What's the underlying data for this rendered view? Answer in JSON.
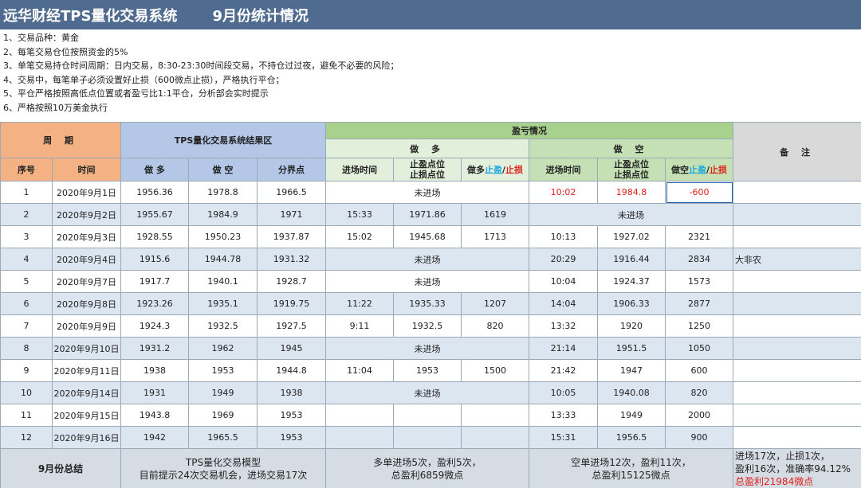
{
  "title": "远华财经TPS量化交易系统",
  "month_title": "9月份统计情况",
  "rules": [
    "1、交易品种：黄金",
    "2、每笔交易仓位按照资金的5%",
    "3、单笔交易持仓时间周期：日内交易，8:30-23:30时间段交易，不持仓过过夜，避免不必要的风险；",
    "4、交易中，每笔单子必须设置好止损（600微点止损），严格执行平仓；",
    "5、平仓严格按照高低点位置或者盈亏比1:1平仓，分析部会实时提示",
    "6、严格按照10万美金执行"
  ],
  "headers": {
    "period": "周  期",
    "tps_area": "TPS量化交易系统结果区",
    "pl": "盈亏情况",
    "long": "做  多",
    "short": "做  空",
    "note": "备  注",
    "seq": "序号",
    "time": "时间",
    "tps_long": "做  多",
    "tps_short": "做  空",
    "boundary": "分界点",
    "long_entry": "进场时间",
    "long_stop_l1": "止盈点位",
    "long_stop_l2": "止损点位",
    "long_pl_prefix": "做多",
    "short_entry": "进场时间",
    "short_stop_l1": "止盈点位",
    "short_stop_l2": "止损点位",
    "short_pl_prefix": "做空",
    "tp_word": "止盈",
    "slash": "/",
    "sl_word": "止损"
  },
  "rows": [
    {
      "seq": "1",
      "date": "2020年9月1日",
      "tps_long": "1956.36",
      "tps_short": "1978.8",
      "boundary": "1966.5",
      "long_merged": "未进场",
      "short_entry": "10:02",
      "short_point": "1984.8",
      "short_pl": "-600",
      "note": ""
    },
    {
      "seq": "2",
      "date": "2020年9月2日",
      "tps_long": "1955.67",
      "tps_short": "1984.9",
      "boundary": "1971",
      "long_entry": "15:33",
      "long_point": "1971.86",
      "long_pl": "1619",
      "short_merged": "未进场",
      "note": ""
    },
    {
      "seq": "3",
      "date": "2020年9月3日",
      "tps_long": "1928.55",
      "tps_short": "1950.23",
      "boundary": "1937.87",
      "long_entry": "15:02",
      "long_point": "1945.68",
      "long_pl": "1713",
      "short_entry": "10:13",
      "short_point": "1927.02",
      "short_pl": "2321",
      "note": ""
    },
    {
      "seq": "4",
      "date": "2020年9月4日",
      "tps_long": "1915.6",
      "tps_short": "1944.78",
      "boundary": "1931.32",
      "long_merged": "未进场",
      "short_entry": "20:29",
      "short_point": "1916.44",
      "short_pl": "2834",
      "note": "大非农"
    },
    {
      "seq": "5",
      "date": "2020年9月7日",
      "tps_long": "1917.7",
      "tps_short": "1940.1",
      "boundary": "1928.7",
      "long_merged": "未进场",
      "short_entry": "10:04",
      "short_point": "1924.37",
      "short_pl": "1573",
      "note": ""
    },
    {
      "seq": "6",
      "date": "2020年9月8日",
      "tps_long": "1923.26",
      "tps_short": "1935.1",
      "boundary": "1919.75",
      "long_entry": "11:22",
      "long_point": "1935.33",
      "long_pl": "1207",
      "short_entry": "14:04",
      "short_point": "1906.33",
      "short_pl": "2877",
      "note": ""
    },
    {
      "seq": "7",
      "date": "2020年9月9日",
      "tps_long": "1924.3",
      "tps_short": "1932.5",
      "boundary": "1927.5",
      "long_entry": "9:11",
      "long_point": "1932.5",
      "long_pl": "820",
      "short_entry": "13:32",
      "short_point": "1920",
      "short_pl": "1250",
      "note": ""
    },
    {
      "seq": "8",
      "date": "2020年9月10日",
      "tps_long": "1931.2",
      "tps_short": "1962",
      "boundary": "1945",
      "long_merged": "未进场",
      "short_entry": "21:14",
      "short_point": "1951.5",
      "short_pl": "1050",
      "note": ""
    },
    {
      "seq": "9",
      "date": "2020年9月11日",
      "tps_long": "1938",
      "tps_short": "1953",
      "boundary": "1944.8",
      "long_entry": "11:04",
      "long_point": "1953",
      "long_pl": "1500",
      "short_entry": "21:42",
      "short_point": "1947",
      "short_pl": "600",
      "note": ""
    },
    {
      "seq": "10",
      "date": "2020年9月14日",
      "tps_long": "1931",
      "tps_short": "1949",
      "boundary": "1938",
      "long_merged": "未进场",
      "short_entry": "10:05",
      "short_point": "1940.08",
      "short_pl": "820",
      "note": ""
    },
    {
      "seq": "11",
      "date": "2020年9月15日",
      "tps_long": "1943.8",
      "tps_short": "1969",
      "boundary": "1953",
      "long_entry": "",
      "long_point": "",
      "long_pl": "",
      "short_entry": "13:33",
      "short_point": "1949",
      "short_pl": "2000",
      "note": ""
    },
    {
      "seq": "12",
      "date": "2020年9月16日",
      "tps_long": "1942",
      "tps_short": "1965.5",
      "boundary": "1953",
      "long_entry": "",
      "long_point": "",
      "long_pl": "",
      "short_entry": "15:31",
      "short_point": "1956.5",
      "short_pl": "900",
      "note": ""
    }
  ],
  "summary": {
    "title": "9月份总结",
    "tps_l1": "TPS量化交易模型",
    "tps_l2": "目前提示24次交易机会，进场交易17次",
    "long_l1": "多单进场5次，盈利5次，",
    "long_l2": "总盈利6859微点",
    "short_l1": "空单进场12次，盈利11次，",
    "short_l2": "总盈利15125微点",
    "final_l1": "进场17次，止损1次，",
    "final_l2": "盈利16次，准确率94.12%",
    "final_l3": "总盈利21984微点"
  },
  "colors": {
    "title_bar": "#4f6b8f",
    "period_header": "#f4b183",
    "tps_header": "#b4c7e7",
    "pl_header": "#a9d18e",
    "long_header": "#e2efda",
    "short_header": "#c5e0b4",
    "note_header": "#d9d9d9",
    "row_alt": "#dce6f1",
    "take_profit": "#1ea5e0",
    "stop_loss": "#e0201c"
  }
}
